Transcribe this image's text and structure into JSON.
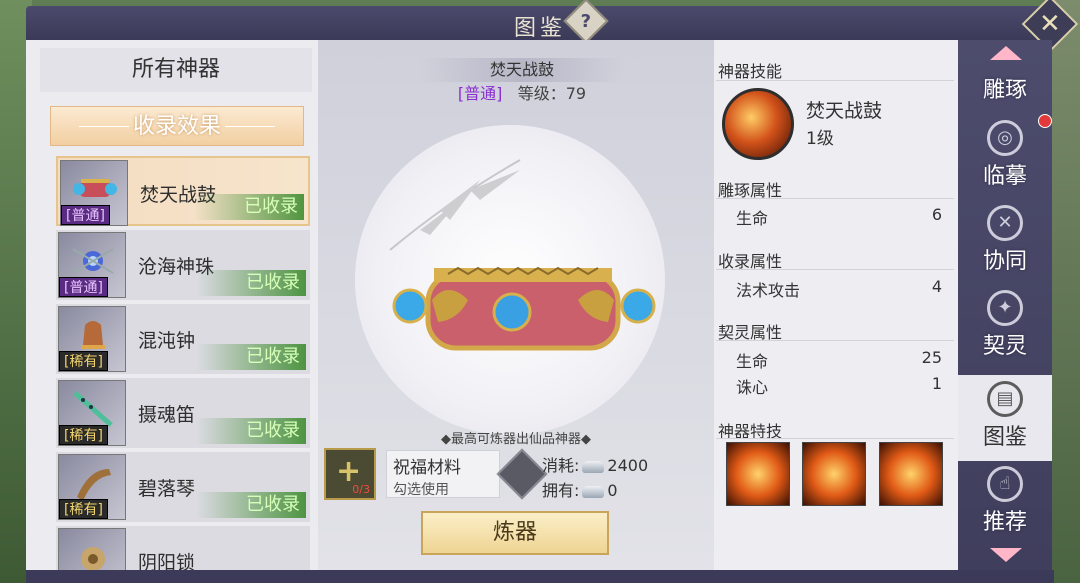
{
  "window": {
    "title": "图鉴",
    "help_label": "?",
    "close_label": "✕"
  },
  "left_panel": {
    "title": "所有神器",
    "collect_effect_button": "收录效果",
    "items": [
      {
        "name": "焚天战鼓",
        "rarity": "[普通]",
        "status": "已收录",
        "selected": true
      },
      {
        "name": "沧海神珠",
        "rarity": "[普通]",
        "status": "已收录",
        "selected": false
      },
      {
        "name": "混沌钟",
        "rarity": "[稀有]",
        "status": "已收录",
        "selected": false
      },
      {
        "name": "摄魂笛",
        "rarity": "[稀有]",
        "status": "已收录",
        "selected": false
      },
      {
        "name": "碧落琴",
        "rarity": "[稀有]",
        "status": "已收录",
        "selected": false
      },
      {
        "name": "阴阳锁",
        "rarity": "",
        "status": "",
        "selected": false
      }
    ]
  },
  "center": {
    "artifact_name": "焚天战鼓",
    "grade": "[普通]",
    "level_label": "等级：79",
    "max_note": "◆最高可炼器出仙品神器◆",
    "material": {
      "icon_count": "0/3",
      "name": "祝福材料",
      "hint": "勾选使用"
    },
    "cost_label": "消耗:",
    "cost_value": "2400",
    "owned_label": "拥有:",
    "owned_value": "0",
    "refine_button": "炼器"
  },
  "right_panel": {
    "skill_title": "神器技能",
    "skill_name": "焚天战鼓",
    "skill_level": "1级",
    "carve_title": "雕琢属性",
    "carve_stats": [
      {
        "label": "生命",
        "value": "6"
      }
    ],
    "collect_title": "收录属性",
    "collect_stats": [
      {
        "label": "法术攻击",
        "value": "4"
      }
    ],
    "spirit_title": "契灵属性",
    "spirit_stats": [
      {
        "label": "生命",
        "value": "25"
      },
      {
        "label": "诛心",
        "value": "1"
      }
    ],
    "tech_title": "神器特技",
    "techs": [
      "fire-slash-icon",
      "flame-sweep-icon",
      "blaze-icon"
    ]
  },
  "nav": {
    "items": [
      {
        "label": "雕琢",
        "icon": "carve-icon"
      },
      {
        "label": "临摹",
        "icon": "copy-swirl-icon"
      },
      {
        "label": "协同",
        "icon": "crossed-swords-icon"
      },
      {
        "label": "契灵",
        "icon": "spirit-star-icon"
      },
      {
        "label": "图鉴",
        "icon": "book-icon"
      },
      {
        "label": "推荐",
        "icon": "thumbs-up-icon"
      }
    ],
    "active": "图鉴",
    "accent_color": "#ffb6c8",
    "notice_dot_color": "#e23a3a"
  }
}
